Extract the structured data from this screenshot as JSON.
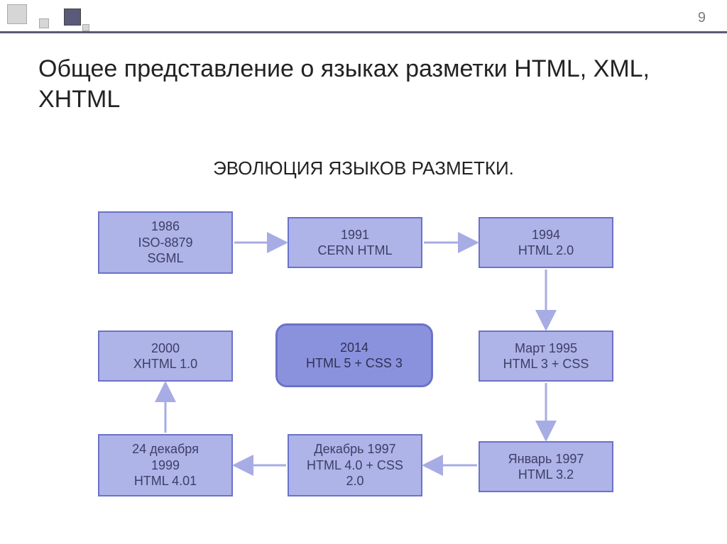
{
  "slide_number": "9",
  "title": "Общее представление о языках разметки HTML, XML, XHTML",
  "subtitle": "ЭВОЛЮЦИЯ ЯЗЫКОВ РАЗМЕТКИ.",
  "boxes": {
    "b1": {
      "line1": "1986",
      "line2": "ISO-8879",
      "line3": "SGML"
    },
    "b2": {
      "line1": "1991",
      "line2": "CERN HTML"
    },
    "b3": {
      "line1": "1994",
      "line2": "HTML 2.0"
    },
    "b4": {
      "line1": "2000",
      "line2": "XHTML 1.0"
    },
    "b5": {
      "line1": "2014",
      "line2": "HTML 5 + CSS 3"
    },
    "b6": {
      "line1": "Март 1995",
      "line2": "HTML 3 +  CSS"
    },
    "b7": {
      "line1": "24 декабря",
      "line2": "1999",
      "line3": "HTML 4.01"
    },
    "b8": {
      "line1": "Декабрь 1997",
      "line2": "HTML 4.0 + CSS",
      "line3": "2.0"
    },
    "b9": {
      "line1": "Январь 1997",
      "line2": "HTML 3.2"
    }
  },
  "colors": {
    "box_fill": "#aeb3e8",
    "box_border": "#6b72c9",
    "highlight_fill": "#8b92dd",
    "arrow": "#a7ace4"
  }
}
